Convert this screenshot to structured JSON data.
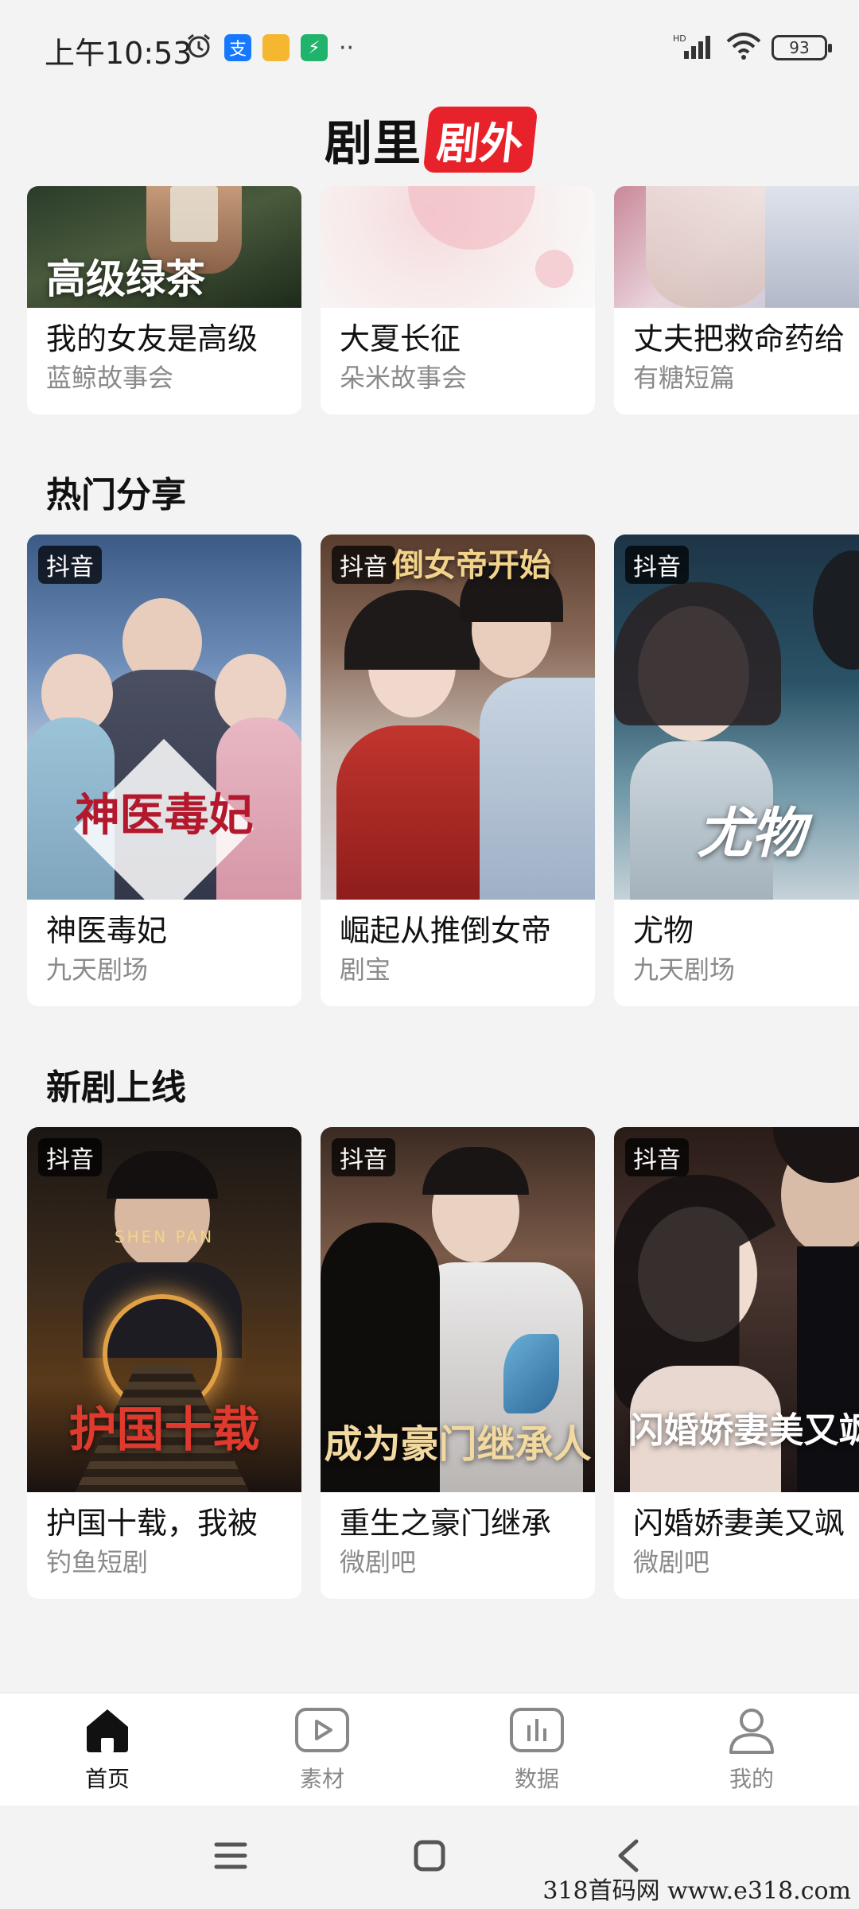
{
  "status_bar": {
    "time": "上午10:53",
    "battery": "93",
    "network": "HD"
  },
  "header": {
    "logo_left": "剧里",
    "logo_right": "剧外"
  },
  "top_row": [
    {
      "title": "我的女友是高级",
      "source": "蓝鲸故事会",
      "poster_text": "高级绿茶"
    },
    {
      "title": "大夏长征",
      "source": "朵米故事会"
    },
    {
      "title": "丈夫把救命药给",
      "source": "有糖短篇"
    }
  ],
  "hot_share": {
    "title": "热门分享",
    "items": [
      {
        "platform": "抖音",
        "title": "神医毒妃",
        "source": "九天剧场",
        "poster_text": "神医毒妃"
      },
      {
        "platform": "抖音",
        "title": "崛起从推倒女帝",
        "source": "剧宝",
        "poster_text": "倒女帝开始"
      },
      {
        "platform": "抖音",
        "title": "尤物",
        "source": "九天剧场",
        "poster_text": "尤物"
      }
    ]
  },
  "new_drama": {
    "title": "新剧上线",
    "items": [
      {
        "platform": "抖音",
        "title": "护国十载，我被",
        "source": "钓鱼短剧",
        "poster_text": "护国十载",
        "poster_sub": "SHEN PAN"
      },
      {
        "platform": "抖音",
        "title": "重生之豪门继承",
        "source": "微剧吧",
        "poster_text": "成为豪门继承人"
      },
      {
        "platform": "抖音",
        "title": "闪婚娇妻美又飒",
        "source": "微剧吧",
        "poster_text": "闪婚娇妻美又飒"
      }
    ]
  },
  "tab_bar": {
    "tabs": [
      {
        "label": "首页",
        "icon": "home-icon"
      },
      {
        "label": "素材",
        "icon": "play-icon"
      },
      {
        "label": "数据",
        "icon": "chart-icon"
      },
      {
        "label": "我的",
        "icon": "profile-icon"
      }
    ]
  },
  "watermark": "318首码网  www.e318.com",
  "colors": {
    "brand_red": "#e8222a",
    "background": "#f3f3f3",
    "text_secondary": "#8a8a8a"
  }
}
